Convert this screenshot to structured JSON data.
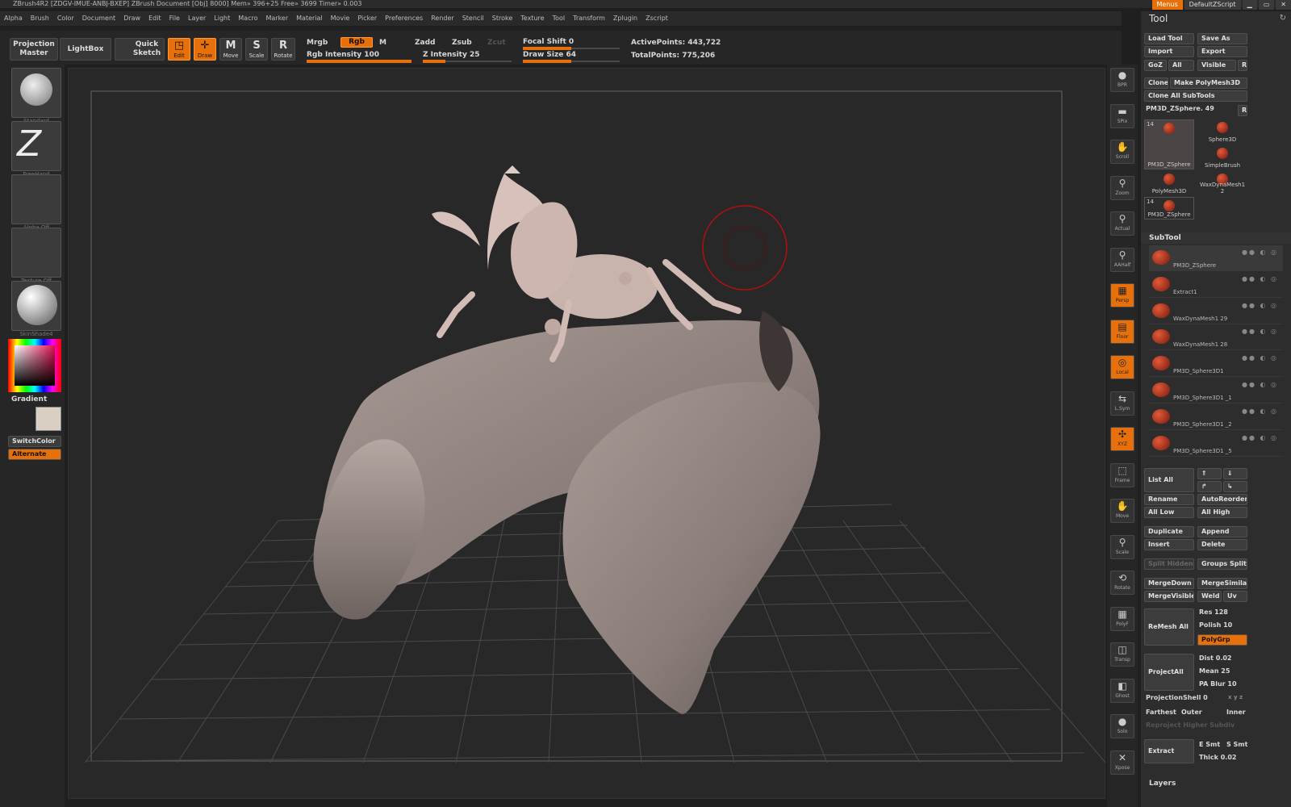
{
  "title_bar": "ZBrush4R2 [ZDGV-IMUE-ANBJ-BXEP]    ZBrush Document    [Obj] 8000] Mem» 396+25 Free» 3699 Timer» 0.003",
  "top_right": {
    "menus": "Menus",
    "script": "DefaultZScript"
  },
  "menu_items": [
    "Alpha",
    "Brush",
    "Color",
    "Document",
    "Draw",
    "Edit",
    "File",
    "Layer",
    "Light",
    "Macro",
    "Marker",
    "Material",
    "Movie",
    "Picker",
    "Preferences",
    "Render",
    "Stencil",
    "Stroke",
    "Texture",
    "Tool",
    "Transform",
    "Zplugin",
    "Zscript"
  ],
  "toolbar": {
    "projection_master": "Projection Master",
    "lightbox": "LightBox",
    "quick_sketch": "Quick Sketch",
    "edit": "Edit",
    "draw": "Draw",
    "move": "Move",
    "scale": "Scale",
    "rotate": "Rotate",
    "mrgb": "Mrgb",
    "rgb": "Rgb",
    "m": "M",
    "zadd": "Zadd",
    "zsub": "Zsub",
    "zcut": "Zcut",
    "rgb_intensity": "Rgb  Intensity 100",
    "z_intensity": "Z Intensity 25",
    "focal_shift": "Focal  Shift 0",
    "draw_size": "Draw  Size 64",
    "active_points": "ActivePoints: 443,722",
    "total_points": "TotalPoints: 775,206",
    "rgb_intensity_value": 100,
    "z_intensity_value": 25,
    "focal_shift_value": 0,
    "draw_size_value": 64
  },
  "left_shelf": {
    "brush": "Standard",
    "stroke": "FreeHand",
    "alpha": "Alpha  Off",
    "texture": "Texture  Off",
    "material": "SkinShade4",
    "gradient": "Gradient",
    "switch_color": "SwitchColor",
    "alternate": "Alternate"
  },
  "right_shelf": [
    "BPR",
    "SPix",
    "Scroll",
    "Zoom",
    "Actual",
    "AAHalf",
    "Persp",
    "Floor",
    "Local",
    "L.Sym",
    "XYZ",
    "Frame",
    "Move",
    "Scale",
    "Rotate",
    "PolyF",
    "Transp",
    "Ghost",
    "Solo",
    "Xpose"
  ],
  "tool_panel": {
    "header": "Tool",
    "load_tool": "Load Tool",
    "save_as": "Save As",
    "import": "Import",
    "export": "Export",
    "goz": "GoZ",
    "all": "All",
    "visible": "Visible",
    "r": "R",
    "clone": "Clone",
    "make_polymesh": "Make PolyMesh3D",
    "clone_all": "Clone  All  SubTools",
    "current_tool": "PM3D_ZSphere. 49",
    "tools": [
      {
        "name": "PM3D_ZSphere",
        "count": "14"
      },
      {
        "name": "Sphere3D",
        "count": ""
      },
      {
        "name": "SimpleBrush",
        "count": ""
      },
      {
        "name": "PolyMesh3D",
        "count": ""
      },
      {
        "name": "WaxDynaMesh1 2",
        "count": ""
      },
      {
        "name": "PM3D_ZSphere",
        "count": "14"
      }
    ]
  },
  "subtool": {
    "header": "SubTool",
    "items": [
      "PM3D_ZSphere",
      "Extract1",
      "WaxDynaMesh1 29",
      "WaxDynaMesh1 28",
      "PM3D_Sphere3D1",
      "PM3D_Sphere3D1 _1",
      "PM3D_Sphere3D1 _2",
      "PM3D_Sphere3D1 _5"
    ],
    "list_all": "List  All",
    "rename": "Rename",
    "auto_reorder": "AutoReorder",
    "all_low": "All  Low",
    "all_high": "All  High",
    "duplicate": "Duplicate",
    "append": "Append",
    "insert": "Insert",
    "delete": "Delete",
    "split_hidden": "Split  Hidden",
    "groups_split": "Groups  Split",
    "merge_down": "MergeDown",
    "merge_similar": "MergeSimilar",
    "merge_visible": "MergeVisible",
    "weld": "Weld",
    "uv": "Uv",
    "remesh_all": "ReMesh  All",
    "res": "Res 128",
    "polish": "Polish 10",
    "polygrp": "PolyGrp",
    "project_all": "ProjectAll",
    "dist": "Dist 0.02",
    "mean": "Mean 25",
    "pa_blur": "PA  Blur 10",
    "projection_shell": "ProjectionShell 0",
    "xyz": "x y z",
    "farthest": "Farthest",
    "outer": "Outer",
    "inner": "Inner",
    "reproject": "Reproject  Higher  Subdiv",
    "extract": "Extract",
    "e_smt": "E  Smt",
    "s_smt": "S  Smt",
    "thick": "Thick 0.02",
    "layers": "Layers"
  }
}
